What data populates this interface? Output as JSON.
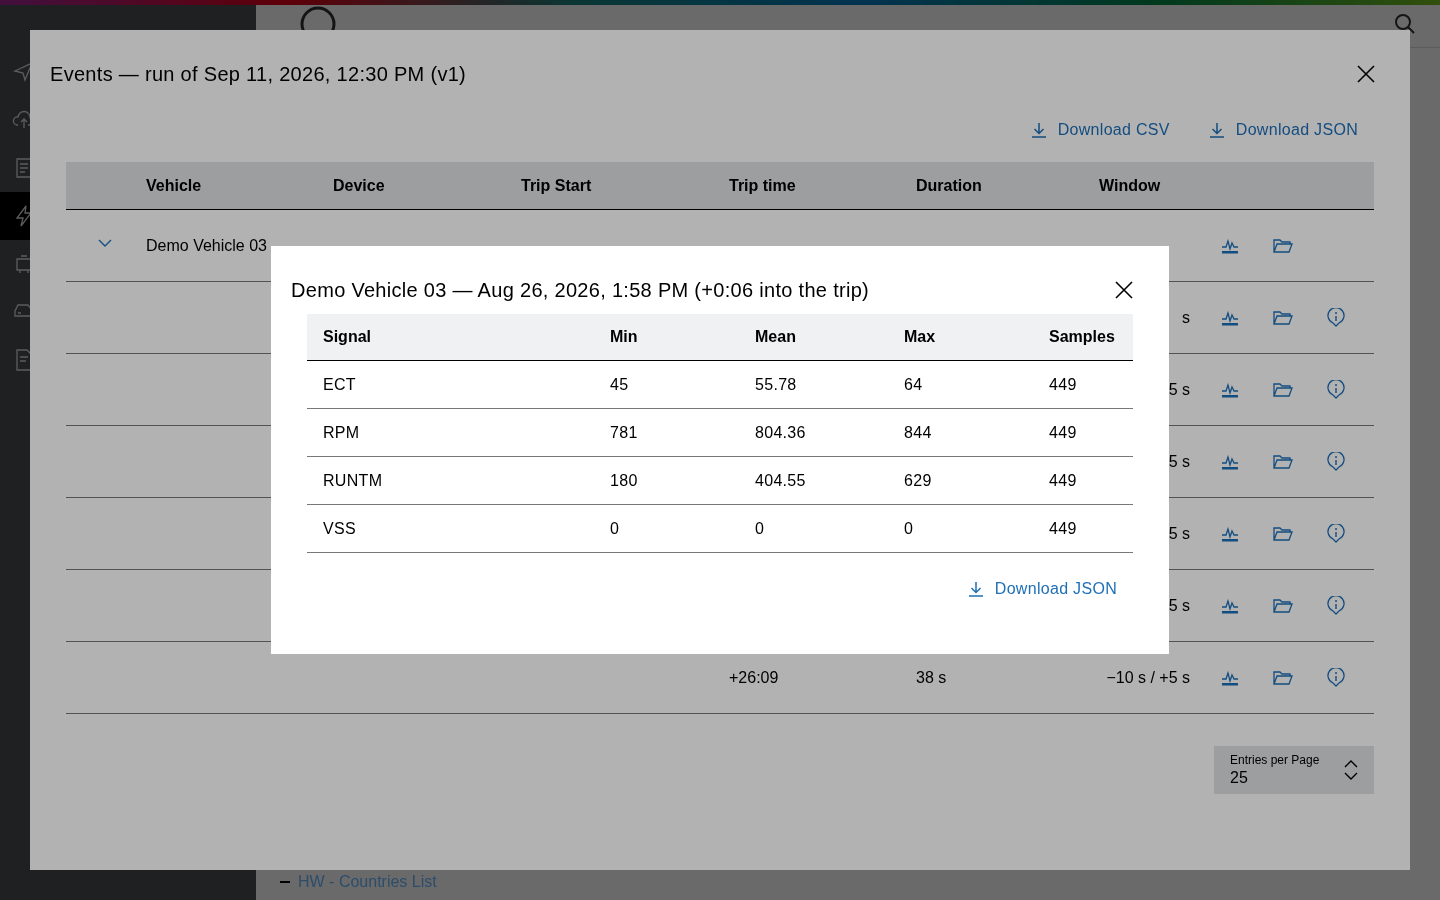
{
  "app": {
    "sidebar": {
      "items": [
        {
          "kind": "send",
          "selected": false
        },
        {
          "kind": "upload",
          "selected": false
        },
        {
          "kind": "checklist",
          "selected": false
        },
        {
          "kind": "bolt",
          "selected": true
        },
        {
          "kind": "device",
          "selected": false
        },
        {
          "kind": "car",
          "selected": false
        },
        {
          "kind": "report",
          "selected": false
        }
      ]
    },
    "footer_link": "HW - Countries List"
  },
  "events_dialog": {
    "title": "Events — run of Sep 11, 2026, 12:30 PM (v1)",
    "actions": [
      {
        "label": "Download CSV"
      },
      {
        "label": "Download JSON"
      }
    ],
    "table": {
      "columns": [
        "Vehicle",
        "Device",
        "Trip Start",
        "Trip time",
        "Duration",
        "Window"
      ],
      "group": {
        "expanded": true,
        "vehicle": "Demo Vehicle 03"
      },
      "rows": [
        {
          "window": "s"
        },
        {
          "window": "5 s"
        },
        {
          "window": "5 s"
        },
        {
          "window": "5 s"
        },
        {
          "window": "5 s"
        },
        {
          "trip_time": "+26:09",
          "duration": "38 s",
          "window": "−10 s / +5 s"
        }
      ]
    },
    "pagination": {
      "label": "Entries per Page",
      "value": "25"
    }
  },
  "signal_dialog": {
    "title": "Demo Vehicle 03 — Aug 26, 2026, 1:58 PM (+0:06 into the trip)",
    "columns": [
      "Signal",
      "Min",
      "Mean",
      "Max",
      "Samples"
    ],
    "rows": [
      [
        "ECT",
        "45",
        "55.78",
        "64",
        "449"
      ],
      [
        "RPM",
        "781",
        "804.36",
        "844",
        "449"
      ],
      [
        "RUNTM",
        "180",
        "404.55",
        "629",
        "449"
      ],
      [
        "VSS",
        "0",
        "0",
        "0",
        "449"
      ]
    ],
    "action": "Download JSON"
  }
}
